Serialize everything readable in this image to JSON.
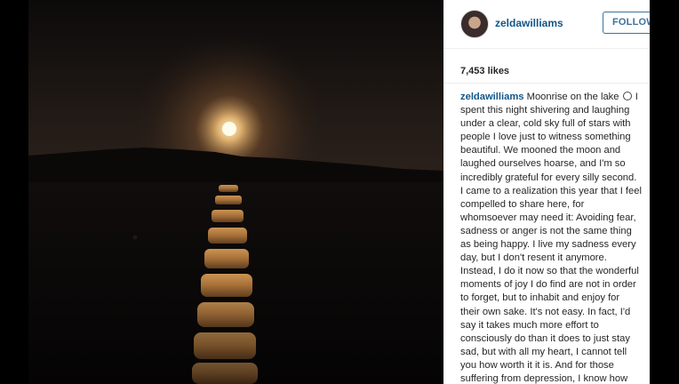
{
  "post": {
    "username": "zeldawilliams",
    "follow_label": "FOLLOW",
    "likes": "7,453 likes",
    "caption": {
      "author": "zeldawilliams",
      "emoji_icon": "moon-icon",
      "first_line_text": "Moonrise on the lake",
      "first_line_tail": "I",
      "lines": [
        "spent this night shivering and laughing",
        "under a clear, cold sky full of stars with",
        "people I love just to witness something",
        "beautiful. We mooned the moon and",
        "laughed ourselves hoarse, and I'm so",
        "incredibly grateful for every silly second.",
        "I came to a realization this year that I feel",
        "compelled to share here, for",
        "whomsoever may need it: Avoiding fear,",
        "sadness or anger is not the same thing",
        "as being happy. I live my sadness every",
        "day, but I don't resent it anymore.",
        "Instead, I do it now so that the wonderful",
        "moments of joy I do find are not in order",
        "to forget, but to inhabit and enjoy for",
        "their own sake. It's not easy. In fact, I'd",
        "say it takes much more effort to",
        "consciously do than it does to just stay",
        "sad, but with all my heart, I cannot tell",
        "you how worth it it is. And for those",
        "suffering from depression, I know how"
      ]
    }
  },
  "photo": {
    "subject": "moonrise-over-lake-photo"
  }
}
